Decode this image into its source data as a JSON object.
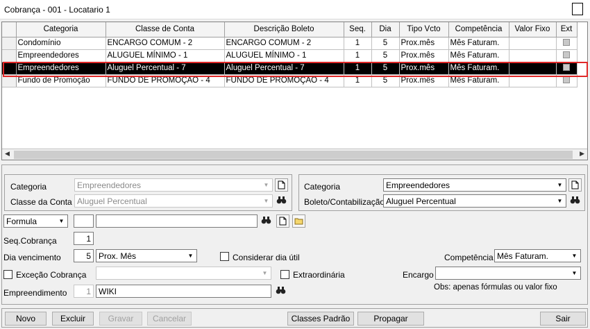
{
  "window": {
    "title": "Cobrança - 001 - Locatario 1"
  },
  "grid": {
    "columns": [
      "Categoria",
      "Classe de Conta",
      "Descrição Boleto",
      "Seq.",
      "Dia",
      "Tipo Vcto",
      "Competência",
      "Valor Fixo",
      "Ext"
    ],
    "rows": [
      {
        "categoria": "Condomínio",
        "classe": "ENCARGO COMUM - 2",
        "descricao": "ENCARGO COMUM - 2",
        "seq": "1",
        "dia": "5",
        "tipo": "Prox.mês",
        "competencia": "Mês Faturam.",
        "valor": ""
      },
      {
        "categoria": "Empreendedores",
        "classe": "ALUGUEL MÍNIMO - 1",
        "descricao": "ALUGUEL MÍNIMO - 1",
        "seq": "1",
        "dia": "5",
        "tipo": "Prox.mês",
        "competencia": "Mês Faturam.",
        "valor": ""
      },
      {
        "categoria": "Empreendedores",
        "classe": "Aluguel Percentual - 7",
        "descricao": "Aluguel Percentual - 7",
        "seq": "1",
        "dia": "5",
        "tipo": "Prox.mês",
        "competencia": "Mês Faturam.",
        "valor": ""
      },
      {
        "categoria": "Fundo de Promoção",
        "classe": "FUNDO DE PROMOÇAO - 4",
        "descricao": "FUNDO DE PROMOÇAO - 4",
        "seq": "1",
        "dia": "5",
        "tipo": "Prox.mês",
        "competencia": "Mês Faturam.",
        "valor": ""
      }
    ]
  },
  "form": {
    "left": {
      "categoria_label": "Categoria",
      "categoria_value": "Empreendedores",
      "classe_label": "Classe da Conta",
      "classe_value": "Aluguel Percentual"
    },
    "right": {
      "categoria_label": "Categoria",
      "categoria_value": "Empreendedores",
      "boleto_label": "Boleto/Contabilização",
      "boleto_value": "Aluguel Percentual"
    },
    "formula_select": "Formula",
    "formula_code": "",
    "formula_text": "",
    "seq_label": "Seq.Cobrança",
    "seq_value": "1",
    "dia_label": "Dia vencimento",
    "dia_value": "5",
    "tipo_value": "Prox. Mês",
    "considerar_label": "Considerar dia útil",
    "competencia_label": "Competência",
    "competencia_value": "Mês Faturam.",
    "excecao_label": "Exceção Cobrança",
    "excecao_value": "",
    "extra_label": "Extraordinária",
    "encargo_label": "Encargo",
    "encargo_value": "",
    "obs_text": "Obs: apenas fórmulas ou valor fixo",
    "empreendimento_label": "Empreendimento",
    "empreendimento_code": "1",
    "empreendimento_value": "WIKI"
  },
  "buttons": {
    "novo": "Novo",
    "excluir": "Excluir",
    "gravar": "Gravar",
    "cancelar": "Cancelar",
    "classes": "Classes Padrão",
    "propagar": "Propagar",
    "sair": "Sair"
  }
}
